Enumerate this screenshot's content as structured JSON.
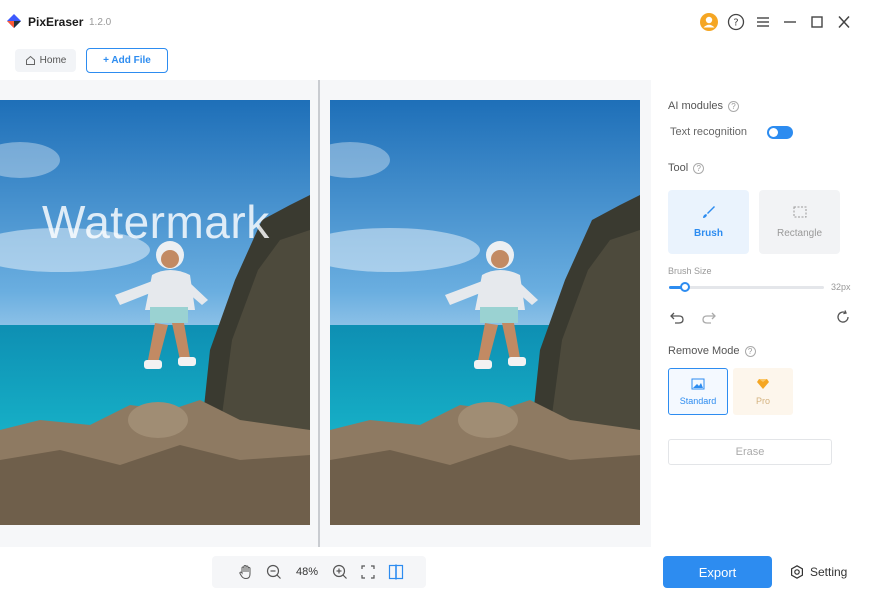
{
  "app": {
    "name": "PixEraser",
    "version": "1.2.0"
  },
  "window_controls": [
    "user-icon",
    "help-icon",
    "menu-icon",
    "minimize-icon",
    "maximize-icon",
    "close-icon"
  ],
  "toolbar": {
    "home_label": "Home",
    "add_file_label": "+ Add File"
  },
  "canvas": {
    "watermark_text": "Watermark"
  },
  "panel": {
    "ai_modules_title": "AI modules",
    "text_recognition_label": "Text recognition",
    "text_recognition_on": true,
    "tool_title": "Tool",
    "tools": [
      {
        "label": "Brush",
        "icon": "brush-icon",
        "selected": true
      },
      {
        "label": "Rectangle",
        "icon": "rectangle-select-icon",
        "selected": false
      }
    ],
    "brush_size_label": "Brush Size",
    "brush_size_value": "32px",
    "brush_size_fraction": 0.1,
    "remove_mode_title": "Remove Mode",
    "modes": [
      {
        "label": "Standard",
        "icon": "image-icon",
        "selected": true
      },
      {
        "label": "Pro",
        "icon": "diamond-icon",
        "selected": false
      }
    ],
    "erase_label": "Erase"
  },
  "zoom": {
    "value": "48%"
  },
  "footer": {
    "export_label": "Export",
    "setting_label": "Setting"
  },
  "colors": {
    "accent": "#2d8cf0",
    "pro": "#f5a623"
  }
}
